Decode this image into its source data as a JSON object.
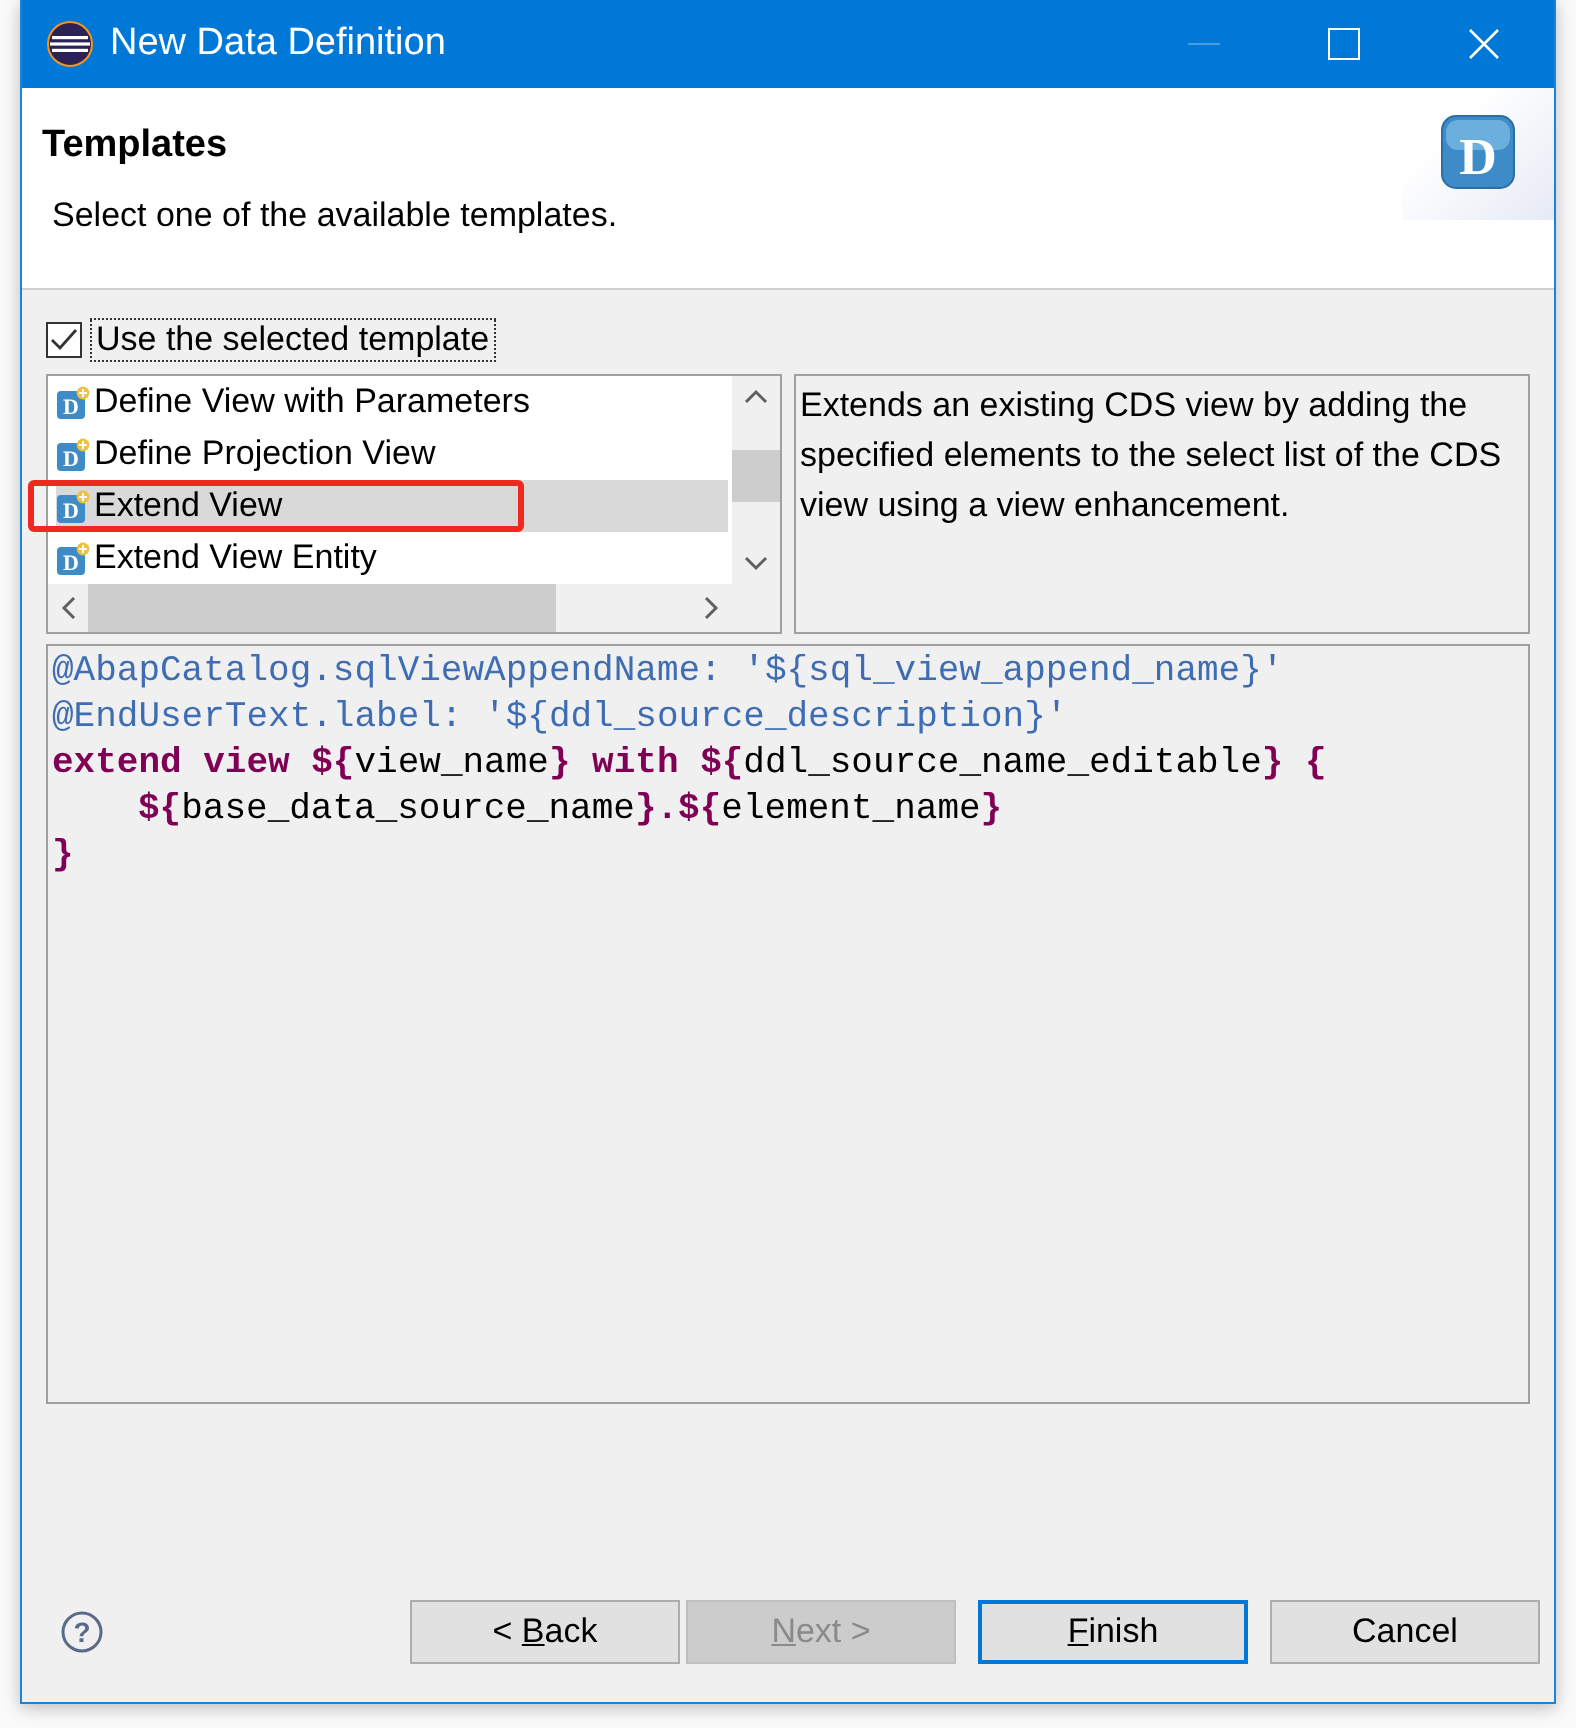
{
  "window": {
    "title": "New Data Definition"
  },
  "header": {
    "title": "Templates",
    "description": "Select one of the available templates.",
    "icon_letter": "D"
  },
  "use_template": {
    "label": "Use the selected template",
    "checked": true
  },
  "templates": [
    {
      "icon_letter": "D",
      "label": "Define View with Parameters",
      "selected": false,
      "highlighted": false
    },
    {
      "icon_letter": "D",
      "label": "Define Projection View",
      "selected": false,
      "highlighted": false
    },
    {
      "icon_letter": "D",
      "label": "Extend View",
      "selected": true,
      "highlighted": true
    },
    {
      "icon_letter": "D",
      "label": "Extend View Entity",
      "selected": false,
      "highlighted": false
    }
  ],
  "template_description": "Extends an existing CDS view by adding the specified elements to the select list of the CDS view using a view enhancement.",
  "code_lines": [
    {
      "indent": false,
      "segments": [
        {
          "kind": "annotation",
          "text": "@AbapCatalog.sqlViewAppendName: '${sql_view_append_name}'"
        }
      ]
    },
    {
      "indent": false,
      "segments": [
        {
          "kind": "annotation",
          "text": "@EndUserText.label: '${ddl_source_description}'"
        }
      ]
    },
    {
      "indent": false,
      "segments": [
        {
          "kind": "keyword",
          "text": "extend view ${"
        },
        {
          "kind": "plain",
          "text": "view_name"
        },
        {
          "kind": "keyword",
          "text": "} with ${"
        },
        {
          "kind": "plain",
          "text": "ddl_source_name_editable"
        },
        {
          "kind": "keyword",
          "text": "} {"
        }
      ]
    },
    {
      "indent": true,
      "segments": [
        {
          "kind": "keyword",
          "text": "${"
        },
        {
          "kind": "plain",
          "text": "base_data_source_name"
        },
        {
          "kind": "keyword",
          "text": "}.${"
        },
        {
          "kind": "plain",
          "text": "element_name"
        },
        {
          "kind": "keyword",
          "text": "}"
        }
      ]
    },
    {
      "indent": false,
      "segments": [
        {
          "kind": "keyword",
          "text": "}"
        }
      ]
    }
  ],
  "buttons": [
    {
      "before": "< ",
      "mnemonic": "B",
      "after": "ack",
      "disabled": false,
      "default": false
    },
    {
      "mnemonic": "N",
      "after": "ext >",
      "disabled": true,
      "default": false
    },
    {
      "mnemonic": "F",
      "after": "inish",
      "disabled": false,
      "default": true
    },
    {
      "before": "Cancel",
      "disabled": false,
      "default": false
    }
  ],
  "help_symbol": "?"
}
